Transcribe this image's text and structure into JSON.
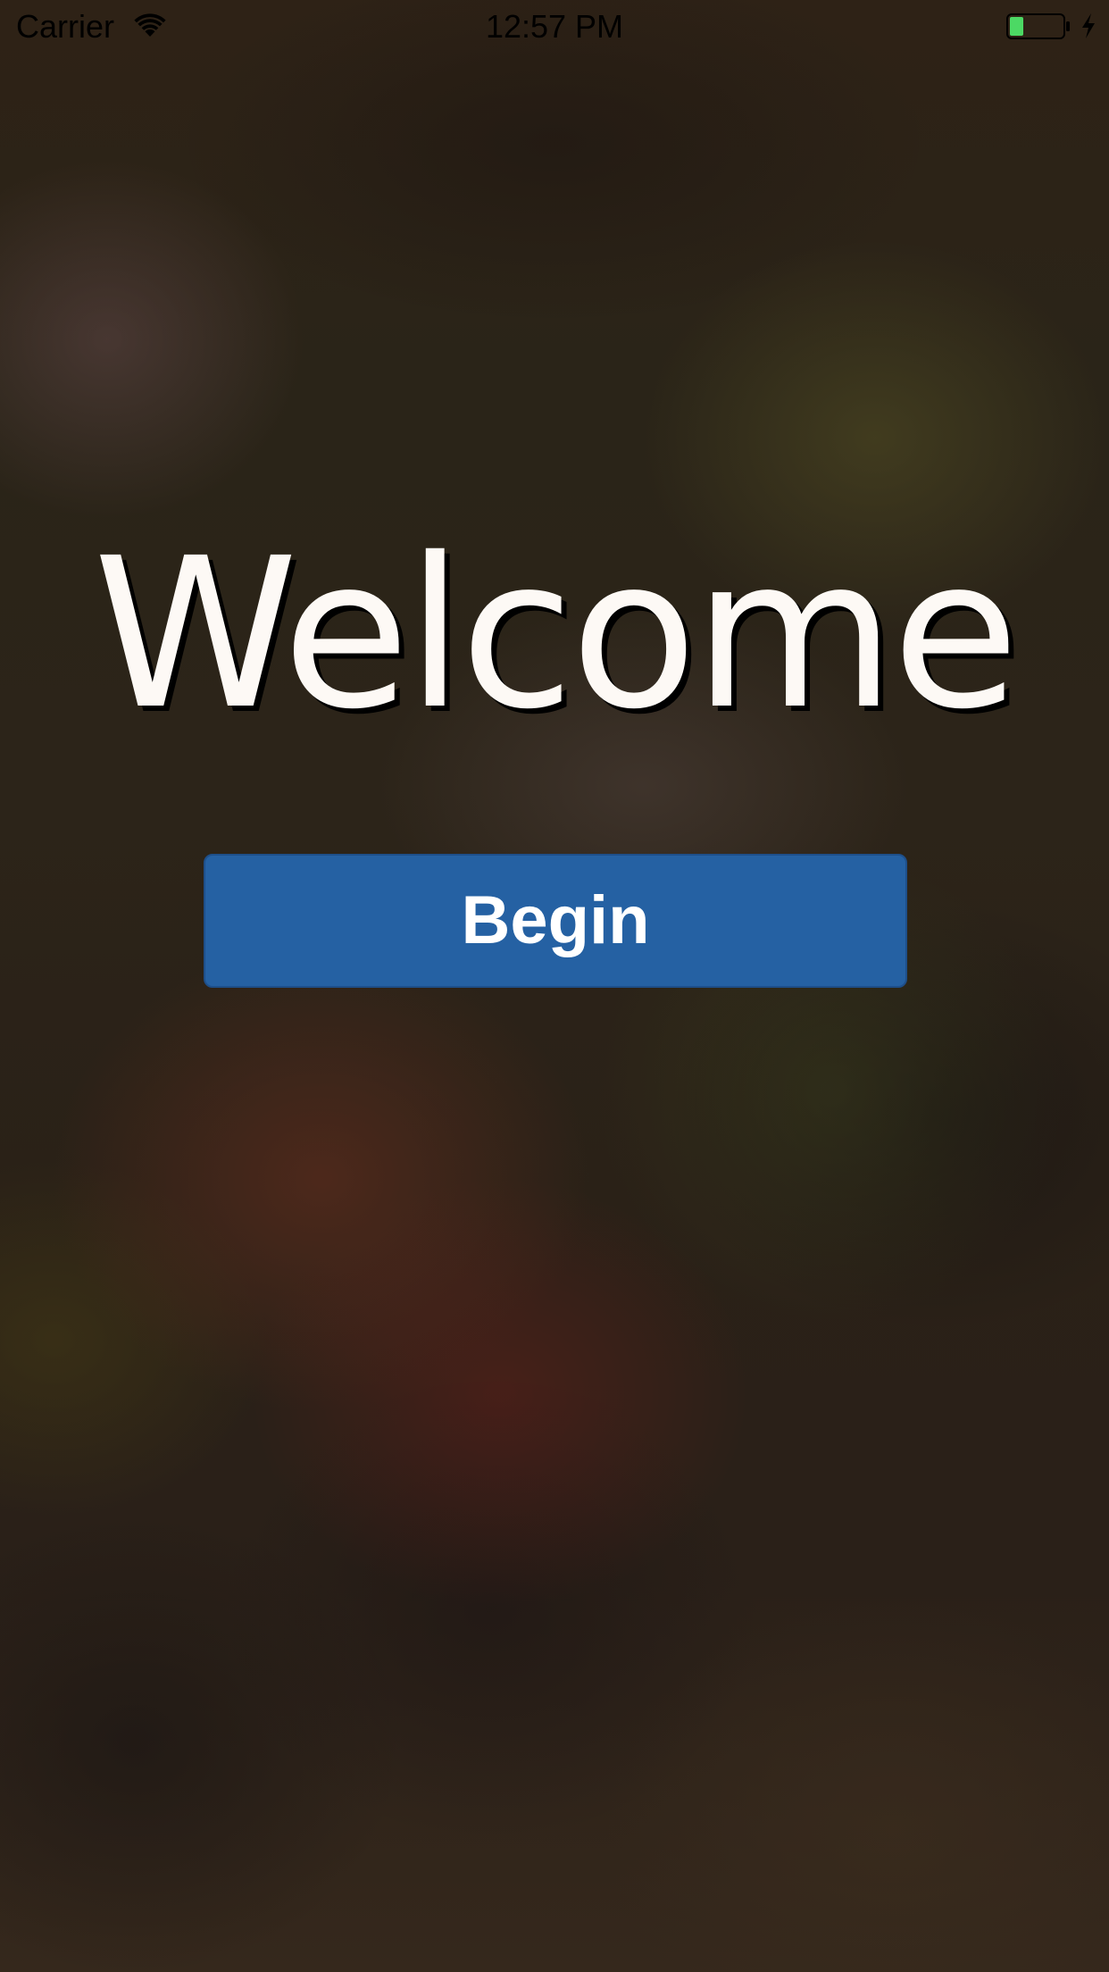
{
  "status_bar": {
    "carrier": "Carrier",
    "time": "12:57 PM",
    "battery_level": 0.25,
    "charging": true,
    "icons": [
      "wifi-icon",
      "battery-icon",
      "charging-bolt-icon"
    ]
  },
  "main": {
    "title": "Welcome",
    "begin_label": "Begin"
  },
  "colors": {
    "button_background": "#2561a3",
    "title_text": "#fdf9f5",
    "battery_fill": "#4cd964"
  }
}
